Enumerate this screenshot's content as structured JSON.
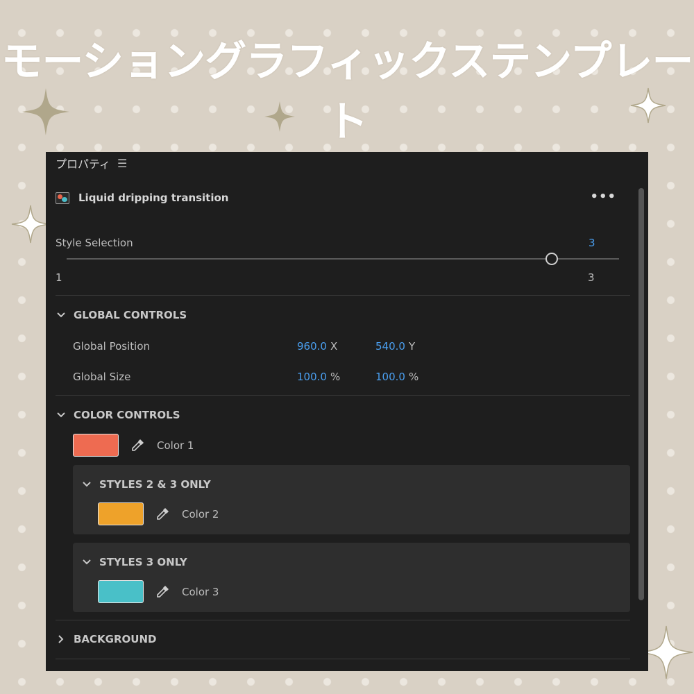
{
  "banner": {
    "title": "モーショングラフィックステンプレート"
  },
  "panel": {
    "title": "プロパティ",
    "menu_icon": "hamburger-menu-icon",
    "layer": {
      "title": "Liquid dripping transition",
      "icon": "template-thumbnail-icon",
      "more_icon": "more-options-icon"
    },
    "style_selection": {
      "label": "Style Selection",
      "value": "3",
      "min": "1",
      "max": "3",
      "level": 1.0
    },
    "global_controls": {
      "heading": "GLOBAL CONTROLS",
      "position": {
        "label": "Global Position",
        "x": "960.0",
        "x_unit": "X",
        "y": "540.0",
        "y_unit": "Y"
      },
      "size": {
        "label": "Global Size",
        "w": "100.0",
        "w_unit": "%",
        "h": "100.0",
        "h_unit": "%"
      }
    },
    "color_controls": {
      "heading": "COLOR CONTROLS",
      "color1": {
        "label": "Color 1",
        "hex": "#ee6b51"
      },
      "styles_2_3": {
        "heading": "STYLES 2 & 3 ONLY",
        "color2": {
          "label": "Color 2",
          "hex": "#eea22a"
        }
      },
      "styles_3": {
        "heading": "STYLES 3 ONLY",
        "color3": {
          "label": "Color 3",
          "hex": "#49c0c8"
        }
      }
    },
    "background": {
      "heading": "BACKGROUND"
    }
  },
  "colors": {
    "accent_blue": "#4a9ff0",
    "panel_bg": "#1e1e1e",
    "group_bg": "#2e2e2e",
    "page_bg": "#d9d1c5"
  }
}
